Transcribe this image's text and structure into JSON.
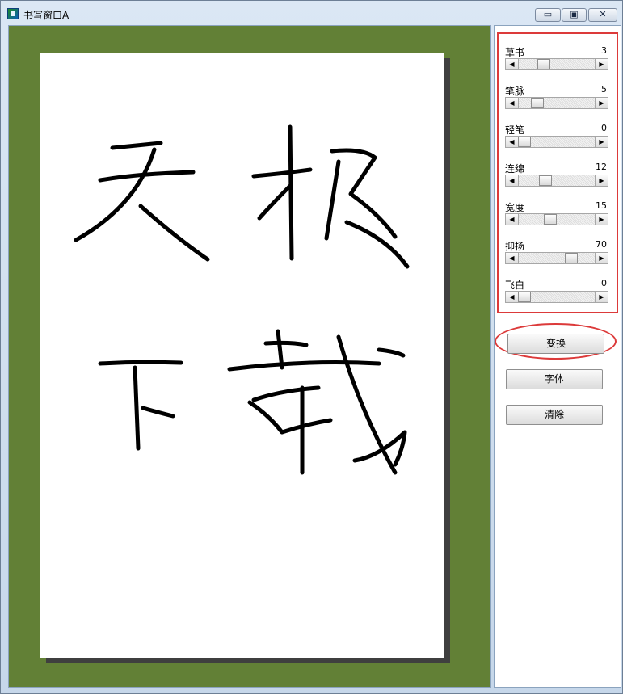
{
  "window": {
    "title": "书写窗口A",
    "buttons": {
      "minimize": "▭",
      "maximize": "▣",
      "close": "✕"
    }
  },
  "canvas": {
    "paper_text": [
      "天",
      "极",
      "下",
      "载"
    ]
  },
  "params": [
    {
      "label": "草书",
      "value": "3",
      "fraction": 0.3
    },
    {
      "label": "笔脉",
      "value": "5",
      "fraction": 0.2
    },
    {
      "label": "轻笔",
      "value": "0",
      "fraction": 0.0
    },
    {
      "label": "连绵",
      "value": "12",
      "fraction": 0.32
    },
    {
      "label": "宽度",
      "value": "15",
      "fraction": 0.4
    },
    {
      "label": "抑扬",
      "value": "70",
      "fraction": 0.73
    },
    {
      "label": "飞白",
      "value": "0",
      "fraction": 0.0
    }
  ],
  "buttons": {
    "transform": "变换",
    "font": "字体",
    "clear": "清除"
  },
  "colors": {
    "canvas_bg": "#628036",
    "highlight": "#dc3a3a"
  }
}
